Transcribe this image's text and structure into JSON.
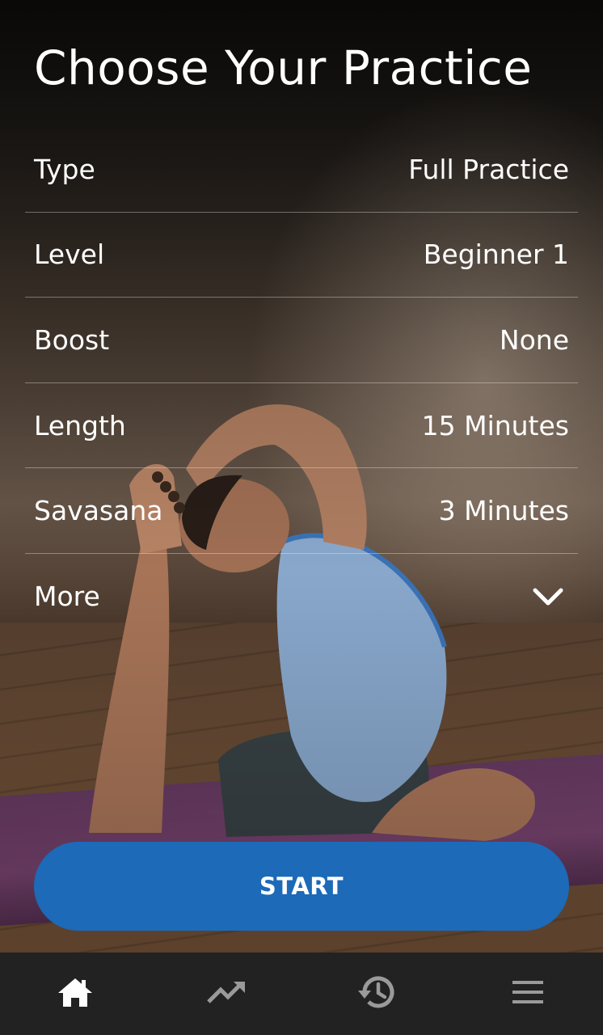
{
  "header": {
    "title": "Choose Your Practice"
  },
  "options": [
    {
      "label": "Type",
      "value": "Full Practice"
    },
    {
      "label": "Level",
      "value": "Beginner 1"
    },
    {
      "label": "Boost",
      "value": "None"
    },
    {
      "label": "Length",
      "value": "15 Minutes"
    },
    {
      "label": "Savasana",
      "value": "3 Minutes"
    },
    {
      "label": "More",
      "icon": "chevron-down-icon"
    }
  ],
  "start_button": {
    "label": "START",
    "color": "#1c6ab8"
  },
  "bottom_nav": {
    "items": [
      {
        "icon": "home-icon",
        "active": true
      },
      {
        "icon": "trending-up-icon",
        "active": false
      },
      {
        "icon": "history-icon",
        "active": false
      },
      {
        "icon": "menu-icon",
        "active": false
      }
    ],
    "active_color": "#ffffff",
    "inactive_color": "#9a9a9a",
    "background": "#222222"
  }
}
